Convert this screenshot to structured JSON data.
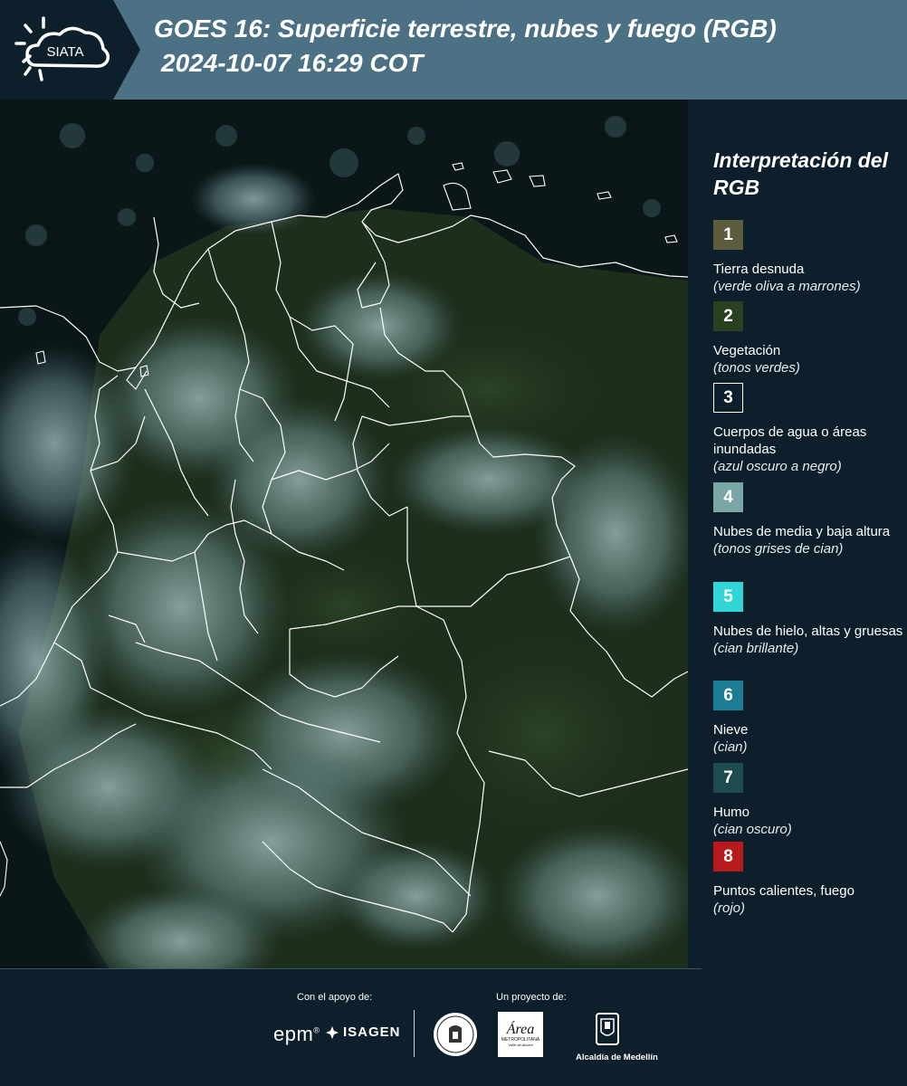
{
  "header": {
    "logo_text": "SIATA",
    "title_line1": "GOES 16: Superficie terrestre, nubes y fuego (RGB)",
    "title_line2": "2024-10-07 16:29 COT",
    "background_color": "#4c7184"
  },
  "map": {
    "description_icon": "satellite-map-image",
    "boundary_color": "#ffffff"
  },
  "legend": {
    "title": "Interpretación del RGB",
    "items": [
      {
        "number": "1",
        "color": "#5b5b3e",
        "label": "Tierra desnuda",
        "sub": "(verde oliva a marrones)"
      },
      {
        "number": "2",
        "color": "#2b3f22",
        "label": "Vegetación",
        "sub": "(tonos verdes)"
      },
      {
        "number": "3",
        "color": "#0c1f2b",
        "label": "Cuerpos de agua o áreas inundadas",
        "sub": "(azul oscuro a negro)"
      },
      {
        "number": "4",
        "color": "#7aa7a5",
        "label": "Nubes de media y baja altura",
        "sub": "(tonos grises de cian)"
      },
      {
        "number": "5",
        "color": "#31d7d7",
        "label": "Nubes de hielo, altas y gruesas",
        "sub": "(cian brillante)"
      },
      {
        "number": "6",
        "color": "#1c7c93",
        "label": "Nieve",
        "sub": "(cian)"
      },
      {
        "number": "7",
        "color": "#1e4b4d",
        "label": "Humo",
        "sub": "(cian oscuro)"
      },
      {
        "number": "8",
        "color": "#b8191d",
        "label": "Puntos calientes, fuego",
        "sub": "(rojo)"
      }
    ]
  },
  "footer": {
    "support_label": "Con el apoyo de:",
    "project_label": "Un proyecto de:",
    "epm": "epm",
    "isagen": "ISAGEN",
    "area_main": "Área",
    "area_sub": "METROPOLITANA",
    "area_sub2": "Valle de Aburrá",
    "alcaldia": "Alcaldía de Medellín"
  }
}
